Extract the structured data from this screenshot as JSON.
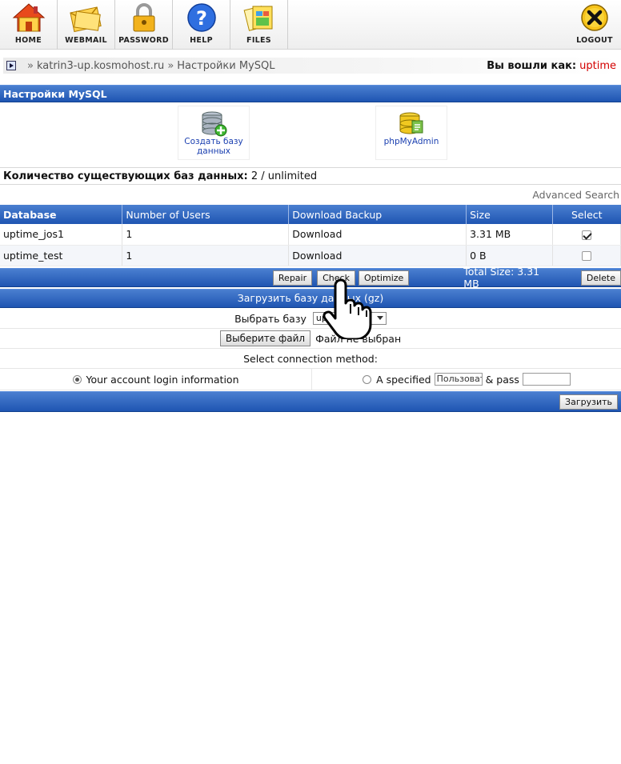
{
  "nav": {
    "items": [
      {
        "label": "HOME",
        "icon": "home-icon"
      },
      {
        "label": "WEBMAIL",
        "icon": "mail-icon"
      },
      {
        "label": "PASSWORD",
        "icon": "lock-icon"
      },
      {
        "label": "HELP",
        "icon": "help-icon"
      },
      {
        "label": "FILES",
        "icon": "files-icon"
      }
    ],
    "logout_label": "LOGOUT"
  },
  "breadcrumb": {
    "host": "katrin3-up.kosmohost.ru",
    "separator": "»",
    "page": "Настройки MySQL",
    "logged_in_label": "Вы вошли как:",
    "username": "uptime"
  },
  "section": {
    "title": "Настройки MySQL",
    "tools": [
      {
        "label": "Создать базу данных",
        "icon": "create-database-icon"
      },
      {
        "label": "phpMyAdmin",
        "icon": "phpmyadmin-icon"
      }
    ],
    "db_count_label": "Количество существующих баз данных:",
    "db_count_value": "2 / unlimited",
    "advanced_search": "Advanced Search"
  },
  "table": {
    "headers": [
      "Database",
      "Number of Users",
      "Download Backup",
      "Size",
      "Select"
    ],
    "rows": [
      {
        "database": "uptime_jos1",
        "users": "1",
        "backup": "Download",
        "size": "3.31 MB",
        "selected": true
      },
      {
        "database": "uptime_test",
        "users": "1",
        "backup": "Download",
        "size": "0 B",
        "selected": false
      }
    ],
    "actions": {
      "repair": "Repair",
      "check": "Check",
      "optimize": "Optimize",
      "total_size": "Total Size: 3.31 MB",
      "delete": "Delete"
    }
  },
  "upload": {
    "title": "Загрузить базу данных (gz)",
    "choose_db_label": "Выбрать базу",
    "choose_db_value": "uptime_jos1",
    "file_button": "Выберите файл",
    "file_status": "Файл не выбран",
    "connection_label": "Select connection method:",
    "option_account": "Your account login information",
    "option_specified": "A specified",
    "user_placeholder": "Пользователь",
    "pass_label": "& pass",
    "submit": "Загрузить"
  },
  "colors": {
    "bar_blue": "#2a5fbd",
    "link_blue": "#1a3fb0",
    "username_red": "#d40000"
  }
}
